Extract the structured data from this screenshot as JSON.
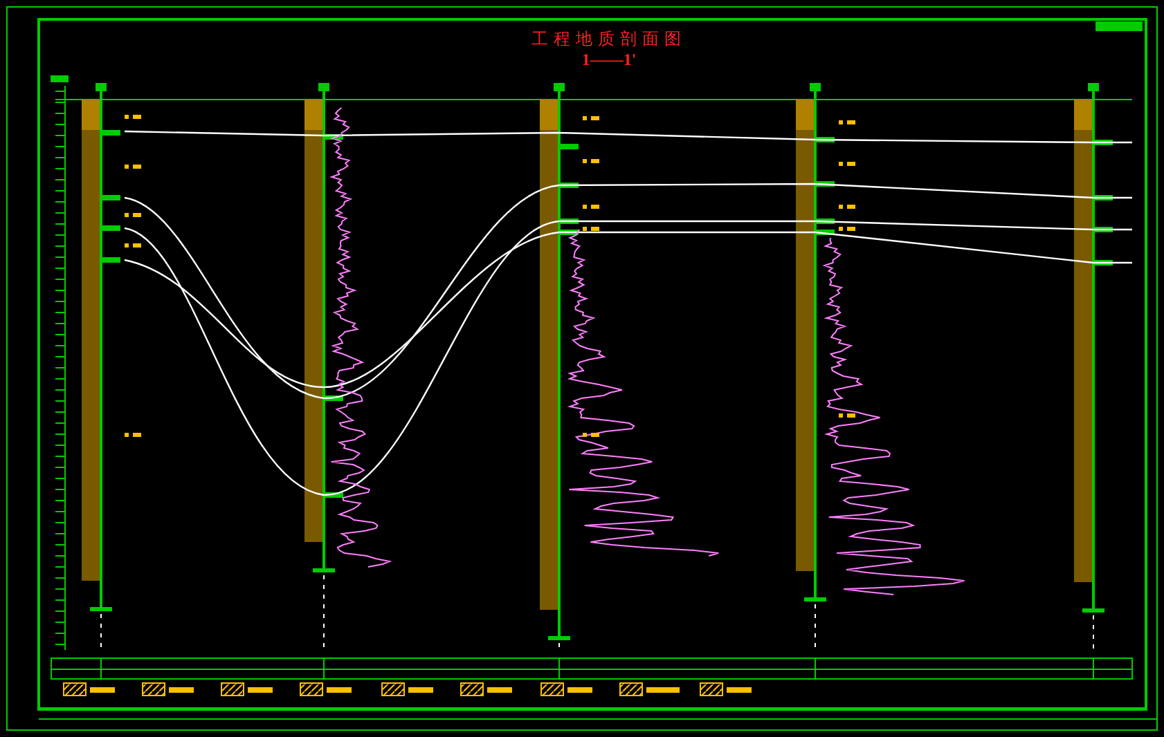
{
  "title": "工程地质剖面图",
  "section_label": "1——1'"
}
